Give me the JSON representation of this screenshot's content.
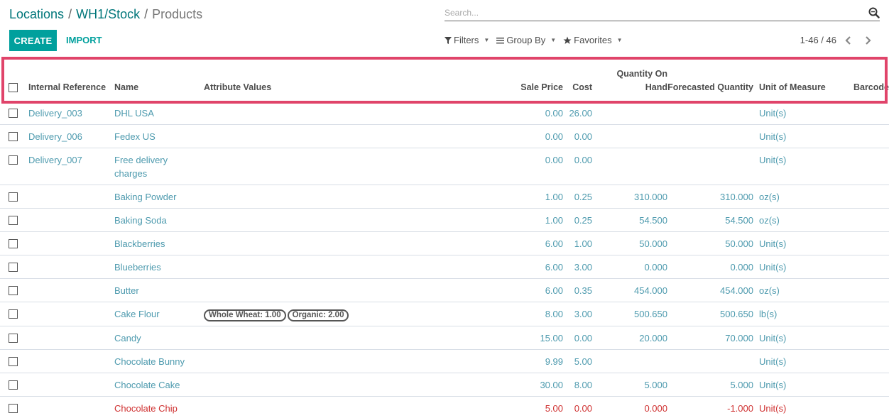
{
  "breadcrumb": {
    "items": [
      "Locations",
      "WH1/Stock"
    ],
    "separator": "/",
    "current": "Products"
  },
  "toolbar": {
    "create_label": "CREATE",
    "import_label": "IMPORT"
  },
  "search": {
    "placeholder": "Search...",
    "value": ""
  },
  "filters": {
    "filters_label": "Filters",
    "group_by_label": "Group By",
    "favorites_label": "Favorites"
  },
  "pager": {
    "text": "1-46 / 46"
  },
  "colors": {
    "brand": "#00a09d",
    "link": "#00767a",
    "row_text": "#4d9aae",
    "danger": "#cf3030",
    "highlight": "#e0446a"
  },
  "table": {
    "headers": {
      "internal_reference": "Internal Reference",
      "name": "Name",
      "attribute_values": "Attribute Values",
      "sale_price": "Sale Price",
      "cost": "Cost",
      "qty_on_hand": "Quantity On Hand",
      "forecasted_qty": "Forecasted Quantity",
      "uom": "Unit of Measure",
      "barcode": "Barcode"
    },
    "rows": [
      {
        "ref": "Delivery_003",
        "name": "DHL USA",
        "attrs": [],
        "price": "0.00",
        "cost": "26.00",
        "onhand": "",
        "forecast": "",
        "uom": "Unit(s)",
        "barcode": "",
        "danger": false
      },
      {
        "ref": "Delivery_006",
        "name": "Fedex US",
        "attrs": [],
        "price": "0.00",
        "cost": "0.00",
        "onhand": "",
        "forecast": "",
        "uom": "Unit(s)",
        "barcode": "",
        "danger": false
      },
      {
        "ref": "Delivery_007",
        "name": "Free delivery charges",
        "attrs": [],
        "price": "0.00",
        "cost": "0.00",
        "onhand": "",
        "forecast": "",
        "uom": "Unit(s)",
        "barcode": "",
        "danger": false
      },
      {
        "ref": "",
        "name": "Baking Powder",
        "attrs": [],
        "price": "1.00",
        "cost": "0.25",
        "onhand": "310.000",
        "forecast": "310.000",
        "uom": "oz(s)",
        "barcode": "",
        "danger": false
      },
      {
        "ref": "",
        "name": "Baking Soda",
        "attrs": [],
        "price": "1.00",
        "cost": "0.25",
        "onhand": "54.500",
        "forecast": "54.500",
        "uom": "oz(s)",
        "barcode": "",
        "danger": false
      },
      {
        "ref": "",
        "name": "Blackberries",
        "attrs": [],
        "price": "6.00",
        "cost": "1.00",
        "onhand": "50.000",
        "forecast": "50.000",
        "uom": "Unit(s)",
        "barcode": "",
        "danger": false
      },
      {
        "ref": "",
        "name": "Blueberries",
        "attrs": [],
        "price": "6.00",
        "cost": "3.00",
        "onhand": "0.000",
        "forecast": "0.000",
        "uom": "Unit(s)",
        "barcode": "",
        "danger": false
      },
      {
        "ref": "",
        "name": "Butter",
        "attrs": [],
        "price": "6.00",
        "cost": "0.35",
        "onhand": "454.000",
        "forecast": "454.000",
        "uom": "oz(s)",
        "barcode": "",
        "danger": false
      },
      {
        "ref": "",
        "name": "Cake Flour",
        "attrs": [
          "Whole Wheat: 1.00",
          "Organic: 2.00"
        ],
        "price": "8.00",
        "cost": "3.00",
        "onhand": "500.650",
        "forecast": "500.650",
        "uom": "lb(s)",
        "barcode": "",
        "danger": false
      },
      {
        "ref": "",
        "name": "Candy",
        "attrs": [],
        "price": "15.00",
        "cost": "0.00",
        "onhand": "20.000",
        "forecast": "70.000",
        "uom": "Unit(s)",
        "barcode": "",
        "danger": false
      },
      {
        "ref": "",
        "name": "Chocolate Bunny",
        "attrs": [],
        "price": "9.99",
        "cost": "5.00",
        "onhand": "",
        "forecast": "",
        "uom": "Unit(s)",
        "barcode": "",
        "danger": false
      },
      {
        "ref": "",
        "name": "Chocolate Cake",
        "attrs": [],
        "price": "30.00",
        "cost": "8.00",
        "onhand": "5.000",
        "forecast": "5.000",
        "uom": "Unit(s)",
        "barcode": "",
        "danger": false
      },
      {
        "ref": "",
        "name": "Chocolate Chip",
        "attrs": [],
        "price": "5.00",
        "cost": "0.00",
        "onhand": "0.000",
        "forecast": "-1.000",
        "uom": "Unit(s)",
        "barcode": "",
        "danger": true
      }
    ]
  }
}
